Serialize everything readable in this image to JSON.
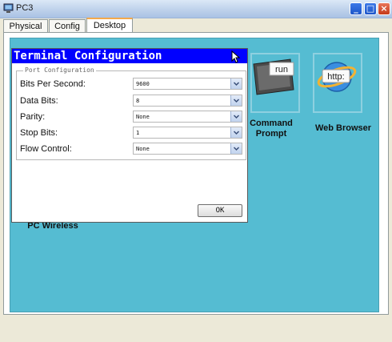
{
  "window": {
    "title": "PC3",
    "controls": {
      "minimize": "_",
      "maximize": "□",
      "close": "×"
    }
  },
  "tabs": [
    {
      "label": "Physical",
      "active": false
    },
    {
      "label": "Config",
      "active": false
    },
    {
      "label": "Desktop",
      "active": true
    }
  ],
  "desktop": {
    "background_color": "#55bcd2",
    "apps": [
      {
        "label_line1": "Command",
        "label_line2": "Prompt",
        "icon": "command-prompt-icon",
        "icon_text": "run"
      },
      {
        "label_line1": "Web Browser",
        "label_line2": "",
        "icon": "web-browser-icon",
        "icon_text": "http:"
      },
      {
        "label_line1": "PC Wireless",
        "label_line2": "",
        "icon": "pc-wireless-icon"
      }
    ]
  },
  "dialog": {
    "title": "Terminal Configuration",
    "title_bar_color": "#0000ff",
    "group_label": "Port Configuration",
    "fields": [
      {
        "label": "Bits Per Second:",
        "value": "9600"
      },
      {
        "label": "Data Bits:",
        "value": "8"
      },
      {
        "label": "Parity:",
        "value": "None"
      },
      {
        "label": "Stop Bits:",
        "value": "1"
      },
      {
        "label": "Flow Control:",
        "value": "None"
      }
    ],
    "ok_label": "OK"
  }
}
